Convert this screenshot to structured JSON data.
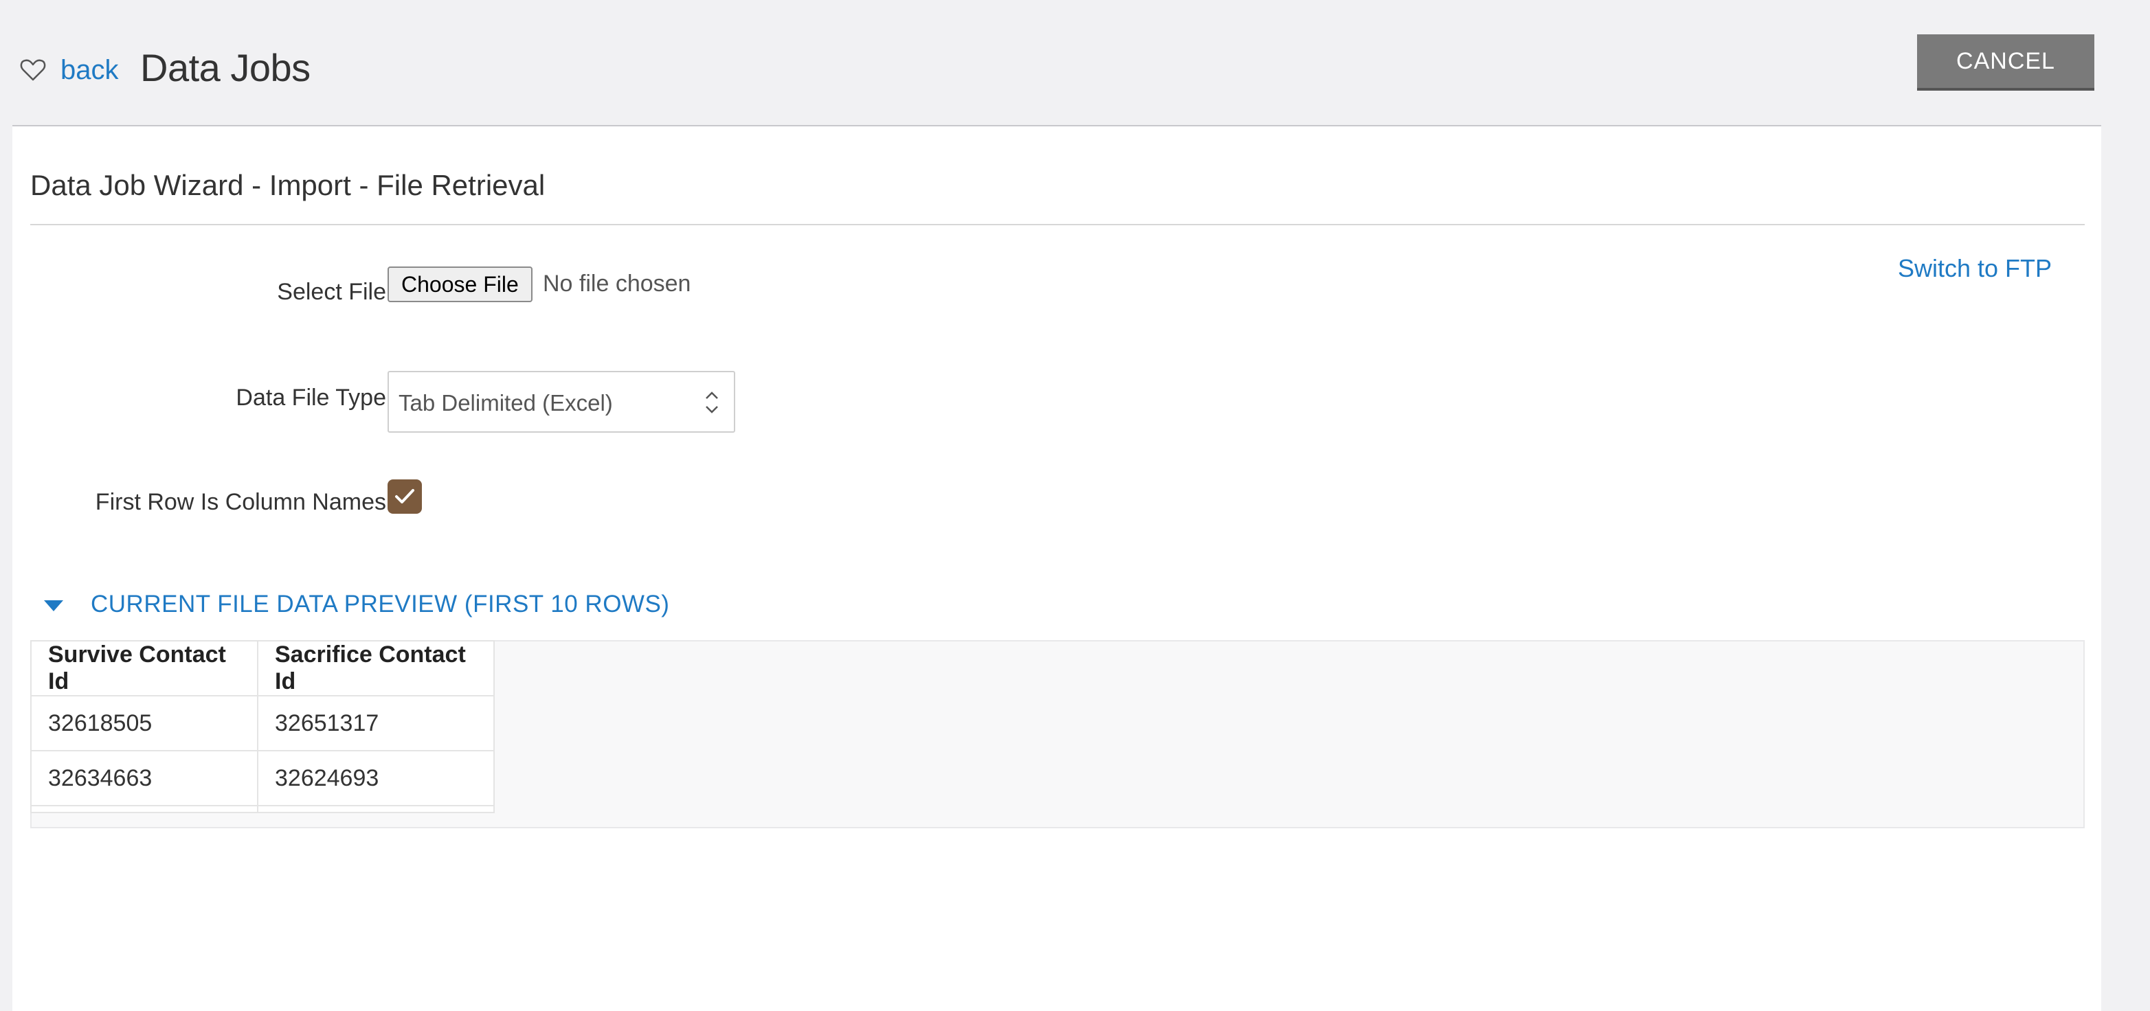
{
  "header": {
    "back_label": "back",
    "title": "Data Jobs",
    "cancel_label": "CANCEL"
  },
  "wizard": {
    "title": "Data Job Wizard - Import - File Retrieval",
    "switch_link": "Switch to FTP",
    "select_file": {
      "label": "Select File",
      "button_label": "Choose File",
      "status": "No file chosen"
    },
    "data_file_type": {
      "label": "Data File Type",
      "value": "Tab Delimited (Excel)"
    },
    "first_row": {
      "label": "First Row Is Column Names",
      "checked": true
    }
  },
  "preview": {
    "toggle_label": "CURRENT FILE DATA PREVIEW (FIRST 10 ROWS)",
    "columns": [
      "Survive Contact Id",
      "Sacrifice Contact Id"
    ],
    "rows": [
      [
        "32618505",
        "32651317"
      ],
      [
        "32634663",
        "32624693"
      ]
    ]
  },
  "colors": {
    "accent": "#1f7ac4",
    "checkbox": "#7b5a3d",
    "cancel_button": "#7a7a7a",
    "page_background": "#f1f1f3"
  },
  "icons": {
    "favorite": "heart-icon",
    "select": "updown-icon",
    "checkbox": "check-icon",
    "toggle": "caret-down-icon"
  }
}
